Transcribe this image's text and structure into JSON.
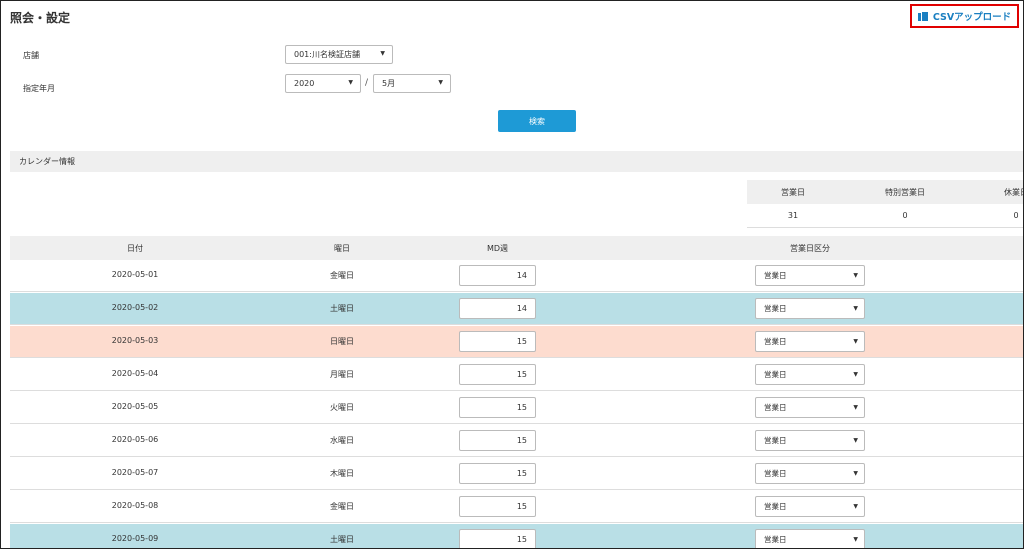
{
  "page": {
    "title": "照会・設定"
  },
  "toolbar": {
    "csv_upload_label": "CSVアップロード"
  },
  "form": {
    "store_label": "店舗",
    "store_value": "001:川名検証店舗",
    "period_label": "指定年月",
    "year_value": "2020",
    "month_value": "5月",
    "separator": "/",
    "search_label": "検索"
  },
  "calendar": {
    "section_title": "カレンダー情報",
    "summary": {
      "headers": [
        "営業日",
        "特別営業日",
        "休業日"
      ],
      "values": [
        "31",
        "0",
        "0"
      ]
    },
    "columns": {
      "date": "日付",
      "weekday": "曜日",
      "md_week": "MD週",
      "business_type": "営業日区分"
    },
    "rows": [
      {
        "date": "2020-05-01",
        "weekday": "金曜日",
        "md_week": "14",
        "type": "営業日",
        "kind": "weekday"
      },
      {
        "date": "2020-05-02",
        "weekday": "土曜日",
        "md_week": "14",
        "type": "営業日",
        "kind": "saturday"
      },
      {
        "date": "2020-05-03",
        "weekday": "日曜日",
        "md_week": "15",
        "type": "営業日",
        "kind": "sunday"
      },
      {
        "date": "2020-05-04",
        "weekday": "月曜日",
        "md_week": "15",
        "type": "営業日",
        "kind": "weekday"
      },
      {
        "date": "2020-05-05",
        "weekday": "火曜日",
        "md_week": "15",
        "type": "営業日",
        "kind": "weekday"
      },
      {
        "date": "2020-05-06",
        "weekday": "水曜日",
        "md_week": "15",
        "type": "営業日",
        "kind": "weekday"
      },
      {
        "date": "2020-05-07",
        "weekday": "木曜日",
        "md_week": "15",
        "type": "営業日",
        "kind": "weekday"
      },
      {
        "date": "2020-05-08",
        "weekday": "金曜日",
        "md_week": "15",
        "type": "営業日",
        "kind": "weekday"
      },
      {
        "date": "2020-05-09",
        "weekday": "土曜日",
        "md_week": "15",
        "type": "営業日",
        "kind": "saturday"
      }
    ]
  },
  "colors": {
    "accent": "#1e9ad6",
    "link": "#1a7fc1",
    "highlight_border": "#e00000",
    "saturday_row": "#b9dfe6",
    "sunday_row": "#fddccf",
    "header_bg": "#efefef"
  },
  "icons": {
    "csv_upload": "document-copy-icon",
    "dropdown": "caret-down-icon"
  }
}
